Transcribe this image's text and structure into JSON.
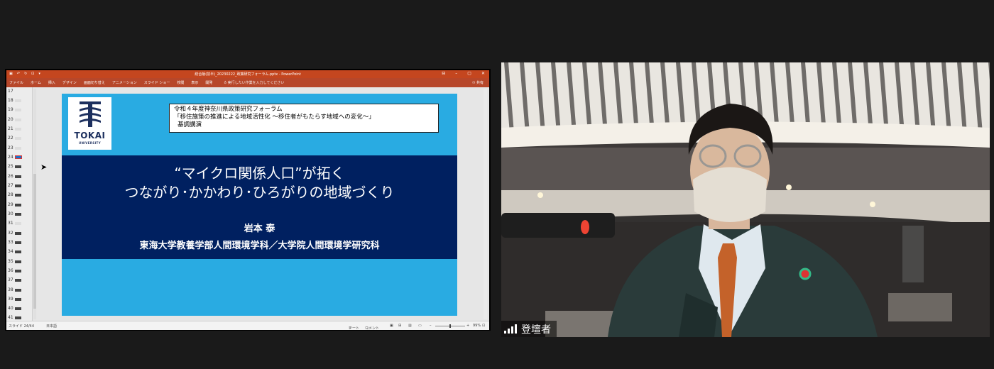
{
  "window_title": "総合版(前半)_20230222_政策研究フォーラム.pptx - PowerPoint",
  "ribbon_tabs": [
    "ファイル",
    "ホーム",
    "挿入",
    "デザイン",
    "画面切り替え",
    "アニメーション",
    "スライド ショー",
    "校閲",
    "表示",
    "開発"
  ],
  "tell_me": "実行したい作業を入力してください",
  "share_label": "共有",
  "thumbnail_numbers": [
    "17",
    "18",
    "19",
    "20",
    "21",
    "22",
    "23",
    "24",
    "25",
    "26",
    "27",
    "28",
    "29",
    "30",
    "31",
    "32",
    "33",
    "34",
    "35",
    "36",
    "37",
    "38",
    "39",
    "40",
    "41"
  ],
  "selected_slide": "24",
  "status": {
    "slide_position": "スライド 24/44",
    "language": "日本語",
    "notes": "ノート",
    "comments": "コメント",
    "zoom": "99%"
  },
  "slide": {
    "logo_text": "TOKAI",
    "logo_subtext": "UNIVERSITY",
    "conference_line1": "令和４年度神奈川県政策研究フォーラム",
    "conference_line2": "「移住施策の推進による地域活性化 ～移住者がもたらす地域への変化～」",
    "conference_line3": "基調講演",
    "title_line1": "“マイクロ関係人口”が拓く",
    "title_line2": "つながり･かかわり･ひろがりの地域づくり",
    "author": "岩本 泰",
    "affiliation": "東海大学教養学部人間環境学科／大学院人間環境学研究科"
  },
  "participant": {
    "name": "登壇者",
    "icon": "signal-bars-icon"
  },
  "colors": {
    "background": "#1a1a1a",
    "ppt_titlebar": "#c4461f",
    "slide_blue": "#29abe2",
    "slide_navy": "#002060"
  }
}
